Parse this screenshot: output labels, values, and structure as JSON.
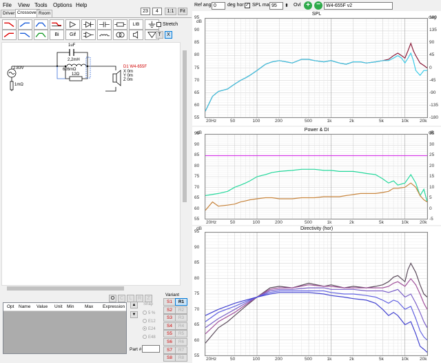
{
  "menu": [
    "File",
    "View",
    "Tools",
    "Options",
    "Help"
  ],
  "tabs": [
    "Drivers",
    "Crossover",
    "Room"
  ],
  "active_tab": "Crossover",
  "zoom": {
    "a": "23",
    "b": "4",
    "fit1": "1:1",
    "fit": "Fit"
  },
  "toolbar": {
    "stretch_label": "Stretch",
    "lib_label": "LIB",
    "bi_label": "Bi",
    "gif_label": "Gif",
    "t_label": "T",
    "x_label": "X"
  },
  "schematic": {
    "cap_label": "1uF",
    "ind_label": "2,2mH",
    "ind_r_label": "626mΩ",
    "res_label": "12Ω",
    "source_v": "2.83V",
    "source_r": "1mΩ",
    "driver_name": "D1 W4-655F",
    "driver_x": "X 0m",
    "driver_y": "Y 0m",
    "driver_z": "Z 0m"
  },
  "params_header": [
    "Opt",
    "Name",
    "Value",
    "Unit",
    "Min",
    "Max",
    "Expression"
  ],
  "snap": {
    "title": "Snap",
    "options": [
      "5 %",
      "E12",
      "E24",
      "E48"
    ],
    "part_label": "Part #",
    "o_label": "O",
    "grey_buttons": [
      "C",
      "L",
      "R",
      "Z"
    ]
  },
  "variant": {
    "title": "Variant",
    "s": [
      "S1",
      "S2",
      "S3",
      "S4",
      "S5",
      "S6",
      "S7",
      "S8"
    ],
    "r": [
      "R1",
      "R2",
      "R3",
      "R4",
      "R5",
      "R6",
      "R7",
      "R8"
    ],
    "active": "R1"
  },
  "top_controls": {
    "ref_angle_label": "Ref angle",
    "ref_angle_value": "0",
    "deg_hor_label": "deg hor",
    "spl_max_label": "SPL max",
    "spl_max_value": "95",
    "ovl_label": "Ovl",
    "driver_select": "W4-655F v2"
  },
  "charts": {
    "spl": {
      "title": "SPL",
      "y_left_unit": "dB",
      "y_right_unit": "deg",
      "y_left_ticks": [
        "95",
        "90",
        "85",
        "80",
        "75",
        "70",
        "65",
        "60",
        "55"
      ],
      "y_right_ticks": [
        "180",
        "135",
        "90",
        "45",
        "0",
        "-45",
        "-90",
        "-135",
        "-180"
      ]
    },
    "power": {
      "title": "Power & DI",
      "y_left_unit": "dB",
      "y_right_unit": "dB",
      "y_left_ticks": [
        "95",
        "90",
        "85",
        "80",
        "75",
        "70",
        "65",
        "60",
        "55"
      ],
      "y_right_ticks": [
        "35",
        "30",
        "25",
        "20",
        "15",
        "10",
        "5",
        "0",
        "-5"
      ]
    },
    "directivity": {
      "title": "Directivity (hor)",
      "y_left_unit": "dB",
      "y_left_ticks": [
        "95",
        "90",
        "85",
        "80",
        "75",
        "70",
        "65",
        "60",
        "55"
      ]
    },
    "x_ticks": [
      "20Hz",
      "50",
      "100",
      "200",
      "500",
      "1k",
      "2k",
      "5k",
      "10k",
      "20k"
    ]
  },
  "chart_data": [
    {
      "type": "line",
      "title": "SPL",
      "ylabel": "dB",
      "ylim": [
        55,
        95
      ],
      "xlim": [
        20,
        20000
      ],
      "x_scale": "log",
      "series": [
        {
          "name": "",
          "color": "#8b1c3a",
          "x": [
            20,
            25,
            30,
            40,
            50,
            60,
            70,
            80,
            100,
            130,
            160,
            200,
            250,
            300,
            400,
            500,
            600,
            800,
            1000,
            1300,
            1600,
            2000,
            2500,
            3000,
            4000,
            5000,
            6000,
            7000,
            8000,
            9000,
            10000,
            11000,
            12000,
            13000,
            14000,
            16000,
            18000,
            20000
          ],
          "y": [
            57.5,
            63.5,
            65.5,
            66.5,
            68.5,
            70,
            71,
            72,
            74,
            76.5,
            77.5,
            78,
            77.5,
            77,
            78.5,
            78.5,
            78,
            77.5,
            78,
            77,
            76.5,
            77.5,
            77.5,
            77,
            77.5,
            78,
            78.5,
            80,
            81,
            80,
            79,
            82,
            85,
            82,
            80,
            77,
            76,
            75
          ]
        },
        {
          "name": "",
          "color": "#3ccbe8",
          "x": [
            20,
            25,
            30,
            40,
            50,
            60,
            70,
            80,
            100,
            130,
            160,
            200,
            250,
            300,
            400,
            500,
            600,
            800,
            1000,
            1300,
            1600,
            2000,
            2500,
            3000,
            4000,
            5000,
            6000,
            7000,
            8000,
            9000,
            10000,
            11000,
            12000,
            13000,
            14000,
            16000,
            18000,
            20000
          ],
          "y": [
            57.5,
            63.5,
            65.5,
            66.5,
            68.5,
            70,
            71,
            72,
            74,
            76.5,
            77.5,
            78,
            77.5,
            77,
            78.5,
            78.5,
            78,
            77.5,
            78,
            77,
            76.5,
            77.5,
            77.5,
            77,
            77.5,
            78,
            78,
            79,
            80,
            79,
            77,
            79,
            81,
            78,
            74,
            72,
            74,
            74
          ]
        }
      ]
    },
    {
      "type": "line",
      "title": "Power & DI",
      "ylabel": "dB",
      "ylim": [
        55,
        95
      ],
      "xlim": [
        20,
        20000
      ],
      "x_scale": "log",
      "series": [
        {
          "name": "",
          "color": "#d43ce8",
          "x": [
            20,
            20000
          ],
          "y": [
            85,
            85
          ]
        },
        {
          "name": "",
          "color": "#25d89c",
          "x": [
            20,
            30,
            40,
            50,
            60,
            70,
            80,
            100,
            130,
            160,
            200,
            300,
            400,
            500,
            600,
            800,
            1000,
            1300,
            1600,
            2000,
            2500,
            3000,
            4000,
            5000,
            6000,
            7000,
            8000,
            10000,
            12000,
            14000,
            16000,
            18000,
            20000
          ],
          "y": [
            66,
            67,
            68,
            70,
            71,
            72,
            73,
            75,
            76,
            77,
            77.5,
            78,
            78.5,
            78.5,
            78.5,
            78,
            78,
            77.5,
            77.5,
            77.5,
            77,
            76.5,
            76,
            74,
            72,
            73,
            71,
            72,
            76,
            72,
            66,
            69,
            63
          ]
        },
        {
          "name": "",
          "color": "#c7843c",
          "x": [
            20,
            25,
            30,
            40,
            50,
            60,
            70,
            80,
            100,
            130,
            160,
            200,
            300,
            400,
            500,
            600,
            800,
            1000,
            1300,
            1600,
            2000,
            2500,
            3000,
            4000,
            5000,
            6000,
            7000,
            8000,
            10000,
            12000,
            14000,
            16000,
            18000,
            20000
          ],
          "y": [
            59,
            63,
            61,
            61.5,
            62,
            63,
            63.5,
            64,
            64.5,
            65,
            65,
            64.5,
            64.5,
            65,
            65,
            65,
            65.5,
            65.5,
            65.5,
            66,
            66.5,
            67,
            67,
            67,
            67.5,
            68,
            69.5,
            69.5,
            70,
            72,
            70,
            66,
            64,
            63
          ]
        }
      ]
    },
    {
      "type": "line",
      "title": "Directivity (hor)",
      "ylabel": "dB",
      "ylim": [
        55,
        95
      ],
      "xlim": [
        20,
        20000
      ],
      "x_scale": "log",
      "series": [
        {
          "name": "",
          "color": "#5a4a5a",
          "x": [
            20,
            30,
            40,
            50,
            70,
            100,
            150,
            200,
            300,
            500,
            800,
            1000,
            1500,
            2000,
            3000,
            4000,
            5000,
            6000,
            7000,
            8000,
            10000,
            11000,
            12000,
            14000,
            16000,
            18000,
            20000
          ],
          "y": [
            59,
            64,
            66,
            68,
            71,
            74,
            77,
            77.5,
            77,
            78.5,
            77.5,
            78,
            77,
            77.5,
            77,
            77.5,
            78,
            79,
            80.5,
            81,
            79,
            83,
            85,
            82,
            78,
            75,
            74
          ]
        },
        {
          "name": "",
          "color": "#a0509a",
          "x": [
            20,
            30,
            50,
            70,
            100,
            150,
            200,
            300,
            500,
            800,
            1000,
            1500,
            2000,
            3000,
            4000,
            5000,
            6000,
            7000,
            8000,
            10000,
            12000,
            14000,
            16000,
            18000,
            20000
          ],
          "y": [
            62,
            66,
            69,
            71.5,
            74,
            76.5,
            77,
            77,
            78,
            77.5,
            77.5,
            77,
            77,
            77,
            77,
            77,
            77.5,
            78.5,
            79,
            77.5,
            80,
            78,
            75,
            72,
            70
          ]
        },
        {
          "name": "",
          "color": "#7a5fc8",
          "x": [
            20,
            30,
            50,
            70,
            100,
            150,
            200,
            300,
            500,
            800,
            1000,
            1500,
            2000,
            3000,
            4000,
            5000,
            6000,
            7000,
            8000,
            10000,
            12000,
            14000,
            16000,
            18000,
            20000
          ],
          "y": [
            64,
            67,
            70,
            72,
            74,
            76,
            76.5,
            76.5,
            77,
            77,
            76.5,
            76.5,
            76.5,
            76,
            76,
            76,
            75.5,
            76,
            76.5,
            74,
            75,
            72,
            69,
            66,
            64
          ]
        },
        {
          "name": "",
          "color": "#6060e0",
          "x": [
            20,
            30,
            50,
            70,
            100,
            150,
            200,
            300,
            500,
            800,
            1000,
            1500,
            2000,
            3000,
            4000,
            5000,
            6000,
            7000,
            8000,
            10000,
            12000,
            14000,
            16000,
            18000,
            20000
          ],
          "y": [
            66,
            69,
            71,
            72.5,
            74,
            75.5,
            76,
            76,
            76,
            76,
            75.5,
            75,
            75,
            74.5,
            74,
            73,
            72,
            73,
            72.5,
            70,
            71,
            67,
            63,
            61,
            60
          ]
        },
        {
          "name": "",
          "color": "#4040d0",
          "x": [
            20,
            30,
            50,
            70,
            100,
            150,
            200,
            300,
            500,
            800,
            1000,
            1500,
            2000,
            3000,
            4000,
            5000,
            6000,
            7000,
            8000,
            10000,
            12000,
            14000,
            16000,
            18000,
            20000
          ],
          "y": [
            68,
            70,
            72,
            73,
            74,
            75,
            75.5,
            75.5,
            75.5,
            75,
            74.5,
            74,
            73.5,
            73,
            72,
            70,
            68,
            69,
            68,
            65,
            66,
            62,
            58,
            57,
            56
          ]
        }
      ]
    }
  ]
}
